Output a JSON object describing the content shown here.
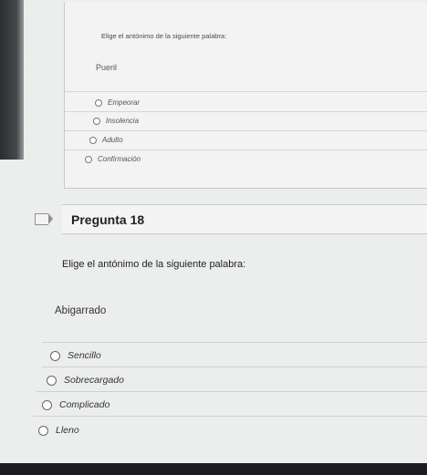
{
  "previous_question": {
    "instruction": "Elige el antónimo de la siguiente palabra:",
    "word": "Pueril",
    "options": [
      "Empeorar",
      "Insolencia",
      "Adulto",
      "Confirmación"
    ]
  },
  "question": {
    "title": "Pregunta 18",
    "instruction": "Elige el antónimo de la siguiente palabra:",
    "word": "Abigarrado",
    "options": [
      "Sencillo",
      "Sobrecargado",
      "Complicado",
      "Lleno"
    ]
  }
}
